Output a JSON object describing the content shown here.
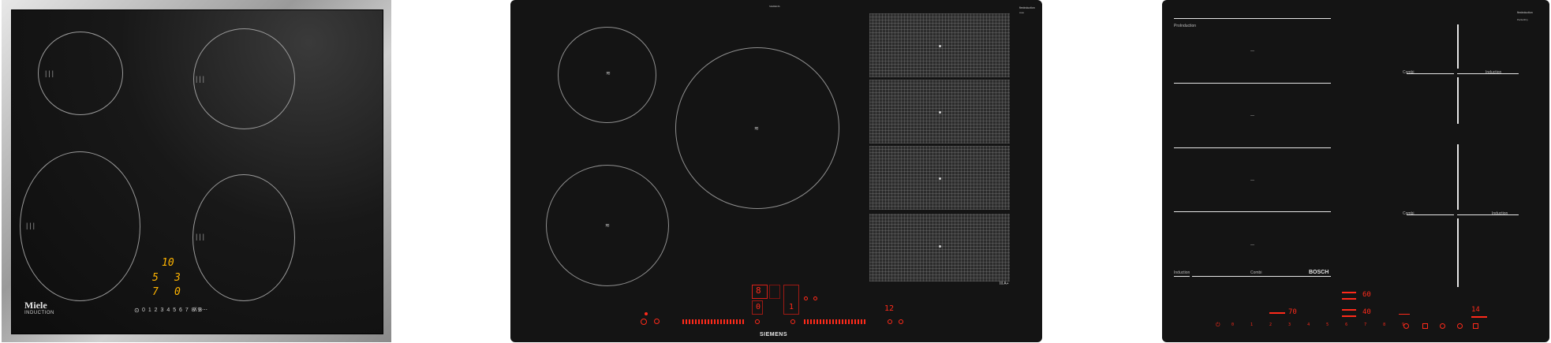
{
  "miele": {
    "brand": "Miele",
    "sub": "INDUCTION",
    "tick": "|||",
    "display": {
      "top": "10",
      "left_mid": "5",
      "right_mid": "3",
      "left_bot": "7",
      "right_bot": "0"
    },
    "scale": "0 1 2 3 4 5 6 7 8 9",
    "misc_left": "⊙",
    "misc_right": "⊼ 3⋯"
  },
  "siemens": {
    "top_label": "SIEMENS",
    "badge_top": "flexInduction",
    "badge_mid": "Auto",
    "zone_symbol": "≋",
    "brand": "SIEMENS",
    "display_left": "8",
    "display_mid": "0",
    "display_right": "1",
    "timer": "12",
    "panel_corner": "III A+"
  },
  "bosch": {
    "badge_top": "flexInduction",
    "badge_mid": "PerfectFry",
    "brand": "BOSCH",
    "left_top_label": "ProInduction",
    "induction_label": "Induction",
    "combi_label": "Combi",
    "center_mark": "—",
    "temp_top": "60",
    "temp_bot": "40",
    "left_value": "70",
    "right_value": "14",
    "power_icon": "⏻",
    "scale": "0 1 2 3 4 5 6 7 8 9"
  },
  "colors": {
    "miele_yellow": "#ffb400",
    "red_display": "#ff2a1a",
    "glass": "#141414"
  }
}
